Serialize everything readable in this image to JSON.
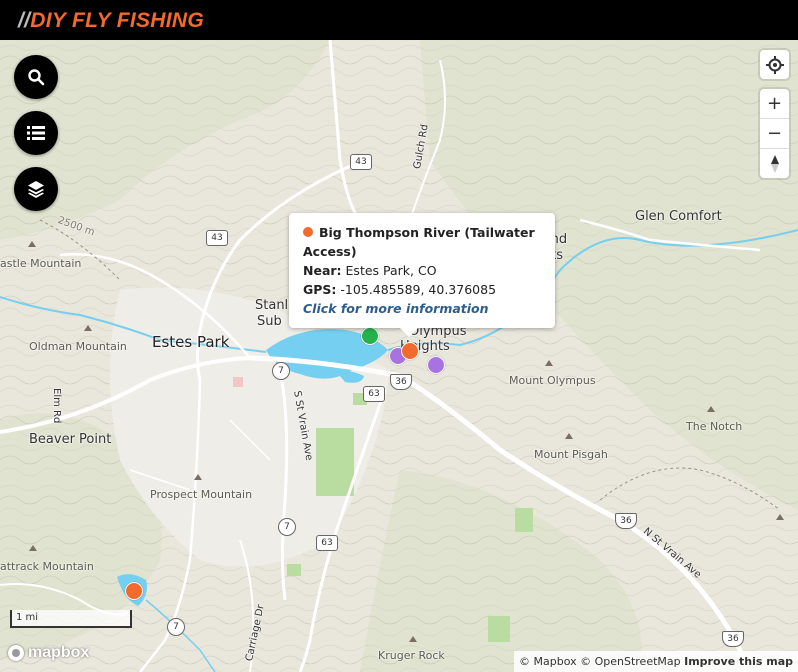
{
  "header": {
    "logo_slashes": "//",
    "logo_text": "DIY FLY FISHING",
    "logo_color": "#f26a2e",
    "background": "#000000"
  },
  "left_controls": [
    {
      "icon": "search-icon"
    },
    {
      "icon": "list-icon"
    },
    {
      "icon": "layers-icon"
    }
  ],
  "right_controls": {
    "geolocate_icon": "crosshair-icon",
    "zoom_in": "+",
    "zoom_out": "−",
    "compass_icon": "compass-icon"
  },
  "map": {
    "towns": [
      "Estes Park"
    ],
    "places": [
      "Glen Comfort",
      "Beaver Point",
      "Stanley",
      "Sub",
      "Olympus",
      "Heights",
      "eland",
      "ights"
    ],
    "peaks": [
      "astle Mountain",
      "Oldman Mountain",
      "Prospect Mountain",
      "attrack Mountain",
      "Mount Olympus",
      "The Notch",
      "Mount Pisgah",
      "Kruger Rock"
    ],
    "roads": [
      "Elm Rd",
      "S St Vrain Ave",
      "Gulch Rd",
      "N St Vrain Ave",
      "Carriage Dr"
    ],
    "contour_label": "2500 m",
    "shields": [
      "43",
      "43",
      "7",
      "7",
      "7",
      "63",
      "63",
      "36",
      "36",
      "36"
    ]
  },
  "markers": [
    {
      "color": "#25b24a",
      "type": "green"
    },
    {
      "color": "#a873e0",
      "type": "purple"
    },
    {
      "color": "#a873e0",
      "type": "purple"
    },
    {
      "color": "#f26a2e",
      "type": "orange"
    },
    {
      "color": "#f26a2e",
      "type": "orange"
    }
  ],
  "popup": {
    "dot_color": "#f26a2e",
    "title": "Big Thompson River (Tailwater Access)",
    "near_label": "Near:",
    "near_value": "Estes Park, CO",
    "gps_label": "GPS:",
    "gps_value": "-105.485589, 40.376085",
    "link": "Click for more information"
  },
  "scale": "1 mi",
  "mapbox_logo": "mapbox",
  "attribution": {
    "mapbox": "© Mapbox",
    "osm": "© OpenStreetMap",
    "improve": "Improve this map"
  }
}
